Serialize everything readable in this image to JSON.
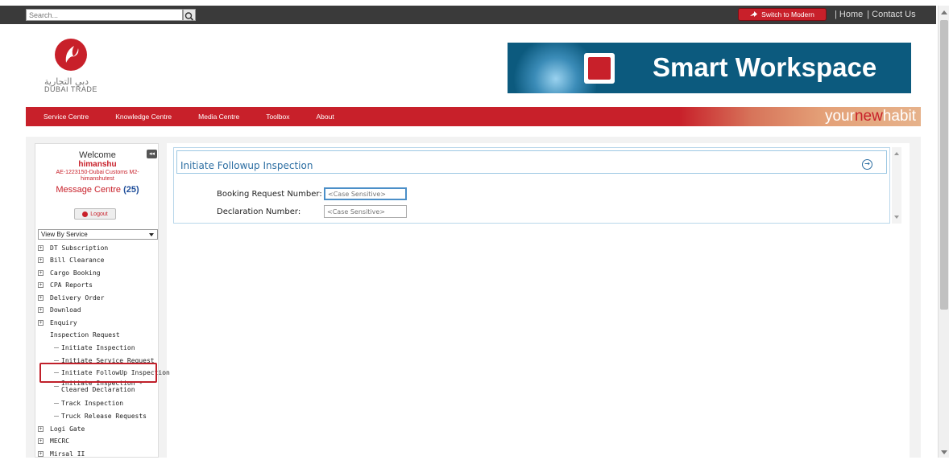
{
  "topbar": {
    "search_placeholder": "Search...",
    "switch_label": "Switch to Modern",
    "links": [
      "| Home",
      "| Contact Us"
    ]
  },
  "header": {
    "logo_arabic": "دبي التجارية",
    "logo_text": "DUBAI TRADE",
    "banner_title": "Smart Workspace"
  },
  "nav": {
    "items": [
      "Service Centre",
      "Knowledge Centre",
      "Media Centre",
      "Toolbox",
      "About"
    ],
    "tagline_pre": "your",
    "tagline_mid": "new",
    "tagline_post": "habit"
  },
  "sidebar": {
    "welcome": "Welcome",
    "username": "himanshu",
    "user_info": "AE-1223150-Dubai Customs M2-himanshutest",
    "message_label": "Message Centre",
    "message_count": "(25)",
    "logout_label": "Logout",
    "view_select": "View By Service",
    "tree": [
      {
        "label": "DT Subscription",
        "expandable": true,
        "child": false
      },
      {
        "label": "Bill Clearance",
        "expandable": true,
        "child": false
      },
      {
        "label": "Cargo Booking",
        "expandable": true,
        "child": false
      },
      {
        "label": "CPA Reports",
        "expandable": true,
        "child": false
      },
      {
        "label": "Delivery Order",
        "expandable": true,
        "child": false
      },
      {
        "label": "Download",
        "expandable": true,
        "child": false
      },
      {
        "label": "Enquiry",
        "expandable": true,
        "child": false
      },
      {
        "label": "Inspection Request",
        "expandable": false,
        "child": false
      },
      {
        "label": "Initiate Inspection",
        "expandable": false,
        "child": true
      },
      {
        "label": "Initiate Service Request",
        "expandable": false,
        "child": true
      },
      {
        "label": "Initiate FollowUp Inspection",
        "expandable": false,
        "child": true
      },
      {
        "label": "Initiate Inspection - Cleared Declaration",
        "expandable": false,
        "child": true
      },
      {
        "label": "Track Inspection",
        "expandable": false,
        "child": true
      },
      {
        "label": "Truck Release Requests",
        "expandable": false,
        "child": true
      },
      {
        "label": "Logi Gate",
        "expandable": true,
        "child": false
      },
      {
        "label": "MECRC",
        "expandable": true,
        "child": false
      },
      {
        "label": "Mirsal II",
        "expandable": true,
        "child": false
      }
    ]
  },
  "panel": {
    "title": "Initiate Followup Inspection",
    "fields": [
      {
        "label": "Booking Request Number:",
        "placeholder": "<Case Sensitive>"
      },
      {
        "label": "Declaration Number:",
        "placeholder": "<Case Sensitive>"
      }
    ]
  },
  "colors": {
    "brand_red": "#c8202a",
    "title_blue": "#2c6ea2"
  }
}
